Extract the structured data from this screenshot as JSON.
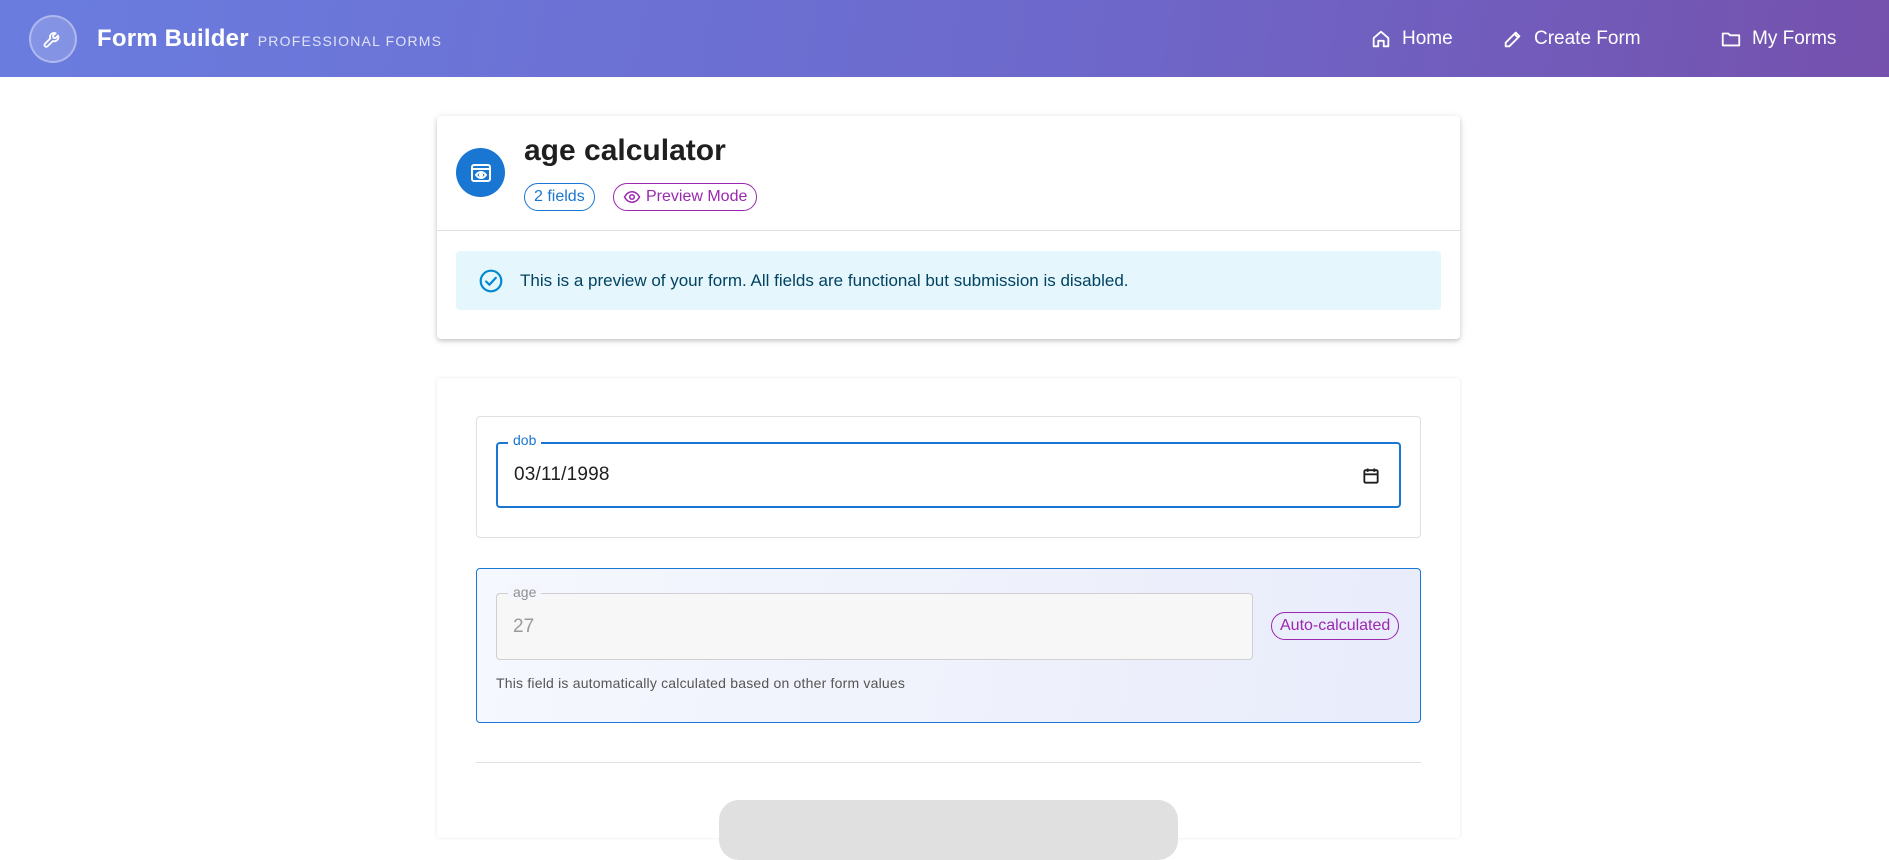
{
  "app": {
    "title": "Form Builder",
    "subtitle": "PROFESSIONAL FORMS"
  },
  "nav": {
    "home": "Home",
    "create": "Create Form",
    "forms": "My Forms"
  },
  "header": {
    "title": "age calculator",
    "fields_chip": "2 fields",
    "preview_chip": "Preview Mode",
    "alert": "This is a preview of your form. All fields are functional but submission is disabled."
  },
  "form": {
    "dob": {
      "label": "dob",
      "value": "03/11/1998"
    },
    "age": {
      "label": "age",
      "value": "27",
      "badge": "Auto-calculated",
      "helper": "This field is automatically calculated based on other form values"
    }
  },
  "colors": {
    "primary": "#1976d2",
    "secondary": "#9c27b0",
    "info_bg": "#e5f6fd",
    "appbar_start": "#6a7ddf",
    "appbar_end": "#7551ad"
  }
}
